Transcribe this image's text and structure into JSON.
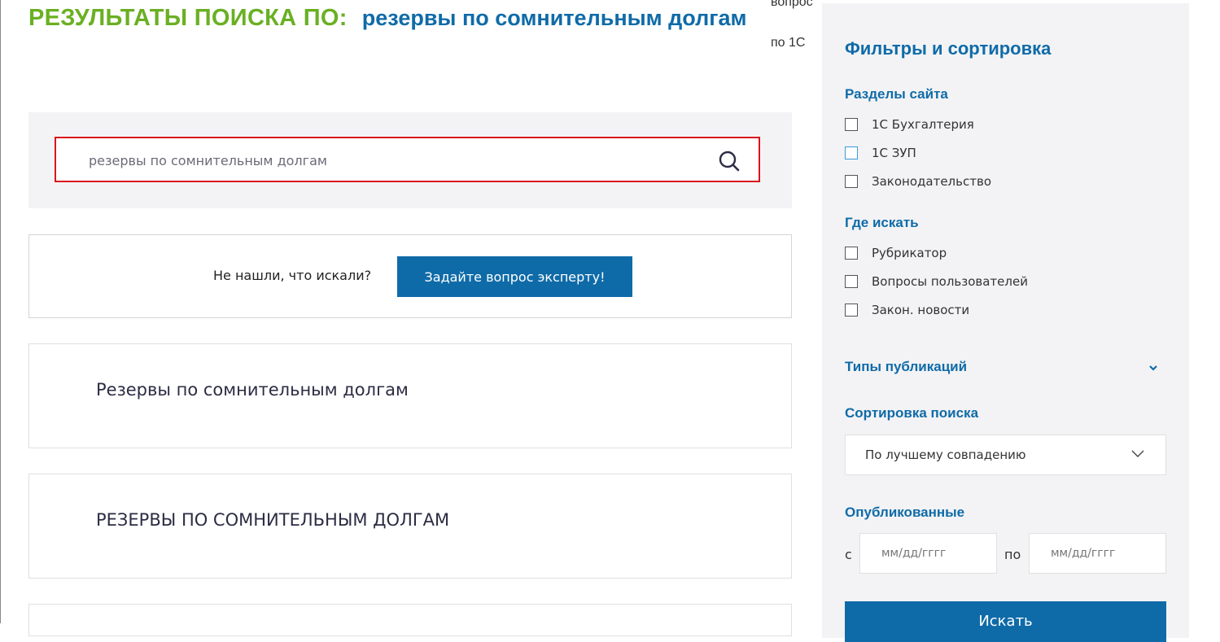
{
  "header": {
    "prefix": "РЕЗУЛЬТАТЫ ПОИСКА ПО:",
    "query": "резервы по сомнительным долгам"
  },
  "behind": {
    "line1": "вопрос",
    "line2": "по 1С"
  },
  "search": {
    "value": "резервы по сомнительным долгам"
  },
  "ask": {
    "text": "Не нашли, что искали?",
    "button": "Задайте вопрос эксперту!"
  },
  "results": [
    {
      "title": "Резервы по сомнительным долгам"
    },
    {
      "title": "РЕЗЕРВЫ ПО СОМНИТЕЛЬНЫМ ДОЛГАМ"
    }
  ],
  "sidebar": {
    "title": "Фильтры и сортировка",
    "sections_heading": "Разделы сайта",
    "sections": [
      "1С Бухгалтерия",
      "1С ЗУП",
      "Законодательство"
    ],
    "where_heading": "Где искать",
    "where": [
      "Рубрикатор",
      "Вопросы пользователей",
      "Закон. новости"
    ],
    "types_heading": "Типы публикаций",
    "sort_heading": "Сортировка поиска",
    "sort_value": "По лучшему совпадению",
    "published_heading": "Опубликованные",
    "from_label": "с",
    "to_label": "по",
    "date_placeholder": "мм/дд/гггг",
    "submit": "Искать"
  },
  "colors": {
    "green": "#6ab023",
    "blue": "#0f6ba8",
    "search_border": "#d9141c"
  }
}
